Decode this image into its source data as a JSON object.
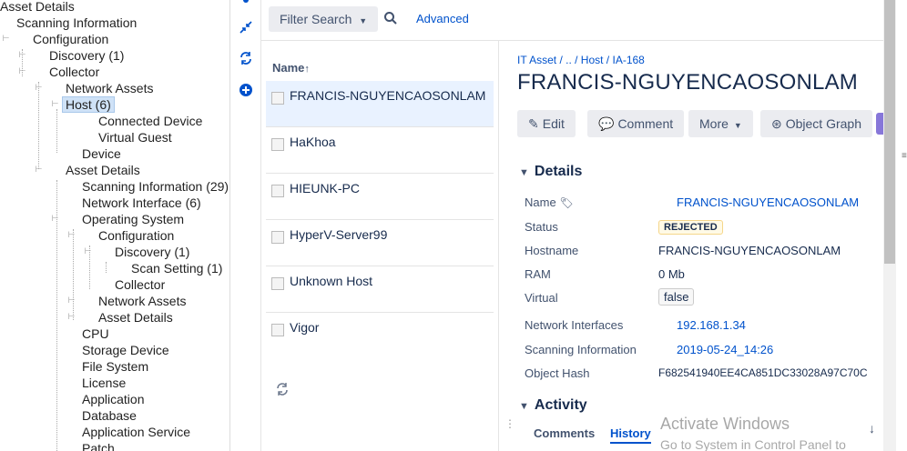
{
  "tree": {
    "items": [
      {
        "label": "Asset Details"
      },
      {
        "label": "Scanning Information"
      },
      {
        "label": "Configuration"
      },
      {
        "label": "Discovery (1)"
      },
      {
        "label": "Collector"
      },
      {
        "label": "Network Assets"
      },
      {
        "label": "Host (6)"
      },
      {
        "label": "Connected Device"
      },
      {
        "label": "Virtual Guest"
      },
      {
        "label": "Device"
      },
      {
        "label": "Asset Details"
      },
      {
        "label": "Scanning Information (29)"
      },
      {
        "label": "Network Interface (6)"
      },
      {
        "label": "Operating System"
      },
      {
        "label": "Configuration"
      },
      {
        "label": "Discovery (1)"
      },
      {
        "label": "Scan Setting (1)"
      },
      {
        "label": "Collector"
      },
      {
        "label": "Network Assets"
      },
      {
        "label": "Asset Details"
      },
      {
        "label": "CPU"
      },
      {
        "label": "Storage Device"
      },
      {
        "label": "File System"
      },
      {
        "label": "License"
      },
      {
        "label": "Application"
      },
      {
        "label": "Database"
      },
      {
        "label": "Application Service"
      },
      {
        "label": "Patch"
      }
    ]
  },
  "iconbar": {
    "icons": [
      "collapse-icon",
      "refresh-icon",
      "add-icon"
    ]
  },
  "toolbar": {
    "filter_label": "Filter Search",
    "advanced_label": "Advanced"
  },
  "list": {
    "header": "Name",
    "items": [
      {
        "label": "FRANCIS-NGUYENCAOSONLAM"
      },
      {
        "label": "HaKhoa"
      },
      {
        "label": "HIEUNK-PC"
      },
      {
        "label": "HyperV-Server99"
      },
      {
        "label": "Unknown Host"
      },
      {
        "label": "Vigor"
      }
    ]
  },
  "detail": {
    "breadcrumb": "IT Asset / .. / Host / IA-168",
    "title": "FRANCIS-NGUYENCAOSONLAM",
    "actions": {
      "edit": "Edit",
      "comment": "Comment",
      "more": "More",
      "object_graph": "Object Graph"
    },
    "details_heading": "Details",
    "fields": {
      "name_label": "Name",
      "name_value": "FRANCIS-NGUYENCAOSONLAM",
      "status_label": "Status",
      "status_value": "REJECTED",
      "hostname_label": "Hostname",
      "hostname_value": "FRANCIS-NGUYENCAOSONLAM",
      "ram_label": "RAM",
      "ram_value": "0 Mb",
      "virtual_label": "Virtual",
      "virtual_value": "false",
      "netif_label": "Network Interfaces",
      "netif_value": "192.168.1.34",
      "scan_label": "Scanning Information",
      "scan_value": "2019-05-24_14:26",
      "hash_label": "Object Hash",
      "hash_value": "F682541940EE4CA851DC33028A97C70C"
    },
    "activity_heading": "Activity",
    "tabs": {
      "comments": "Comments",
      "history": "History"
    }
  },
  "watermark": {
    "line1": "Activate Windows",
    "line2": "Go to System in Control Panel to"
  },
  "colors": {
    "link": "#0052cc",
    "selected": "#e9f2ff",
    "button_bg": "#ebecf0"
  }
}
